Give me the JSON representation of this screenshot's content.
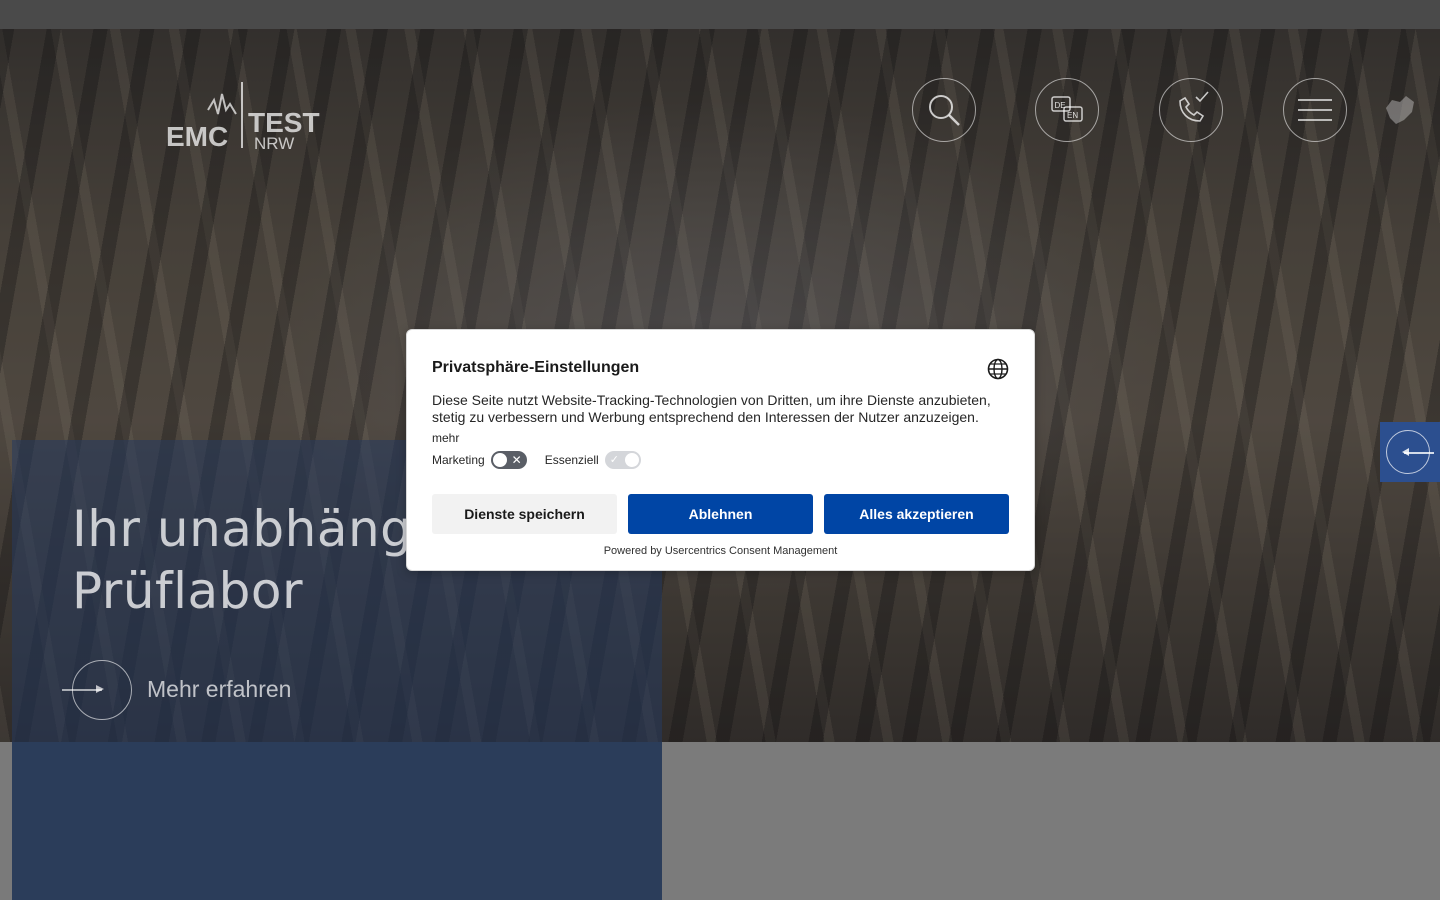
{
  "brand": {
    "logo_left": "EMC",
    "logo_right_top": "TEST",
    "logo_right_bottom": "NRW"
  },
  "header": {
    "icons": [
      "search-icon",
      "language-de-en-icon",
      "phone-icon",
      "menu-icon"
    ],
    "lang_de": "DE",
    "lang_en": "EN"
  },
  "hero": {
    "title": "Ihr unabhängiges EMV-Prüflabor",
    "cta_label": "Mehr erfahren"
  },
  "consent": {
    "title": "Privatsphäre-Einstellungen",
    "description": "Diese Seite nutzt Website-Tracking-Technologien von Dritten, um ihre Dienste anzubieten, stetig zu verbessern und Werbung entsprechend den Interessen der Nutzer anzuzeigen.",
    "more_link": "mehr",
    "toggles": [
      {
        "label": "Marketing",
        "state": "off"
      },
      {
        "label": "Essenziell",
        "state": "on"
      }
    ],
    "buttons": {
      "save": "Dienste speichern",
      "deny": "Ablehnen",
      "accept": "Alles akzeptieren"
    },
    "powered_by": "Powered by Usercentrics Consent Management"
  },
  "colors": {
    "accent_blue": "#0045a5",
    "hero_panel": "#263a5f",
    "side_tab": "#2c4f8f"
  }
}
